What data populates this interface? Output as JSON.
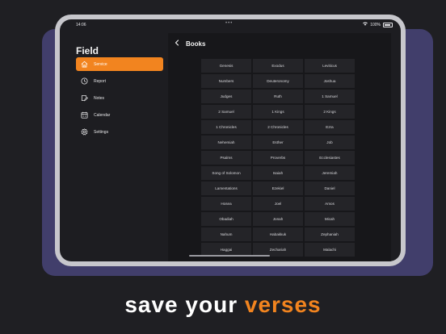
{
  "status_bar": {
    "time": "14:06",
    "dots": "•••",
    "battery": "100%"
  },
  "sidebar": {
    "title": "Field",
    "items": [
      {
        "label": "Service",
        "icon": "home-icon",
        "active": true
      },
      {
        "label": "Report",
        "icon": "clock-icon",
        "active": false
      },
      {
        "label": "Notes",
        "icon": "notes-icon",
        "active": false
      },
      {
        "label": "Calendar",
        "icon": "calendar-icon",
        "active": false
      },
      {
        "label": "Settings",
        "icon": "gear-icon",
        "active": false
      }
    ]
  },
  "main": {
    "title": "Books",
    "books": [
      "Genesis",
      "Exodus",
      "Leviticus",
      "Numbers",
      "Deuteronomy",
      "Joshua",
      "Judges",
      "Ruth",
      "1 Samuel",
      "2 Samuel",
      "1 Kings",
      "2 Kings",
      "1 Chronicles",
      "2 Chronicles",
      "Ezra",
      "Nehemiah",
      "Esther",
      "Job",
      "Psalms",
      "Proverbs",
      "Ecclesiastes",
      "Song of Solomon",
      "Isaiah",
      "Jeremiah",
      "Lamentations",
      "Ezekiel",
      "Daniel",
      "Hosea",
      "Joel",
      "Amos",
      "Obadiah",
      "Jonah",
      "Micah",
      "Nahum",
      "Habakkuk",
      "Zephaniah",
      "Haggai",
      "Zechariah",
      "Malachi"
    ]
  },
  "tagline": {
    "prefix": "save your ",
    "highlight": "verses"
  },
  "colors": {
    "accent": "#f2841f",
    "panel": "#413e6b",
    "background": "#1f1f23"
  }
}
